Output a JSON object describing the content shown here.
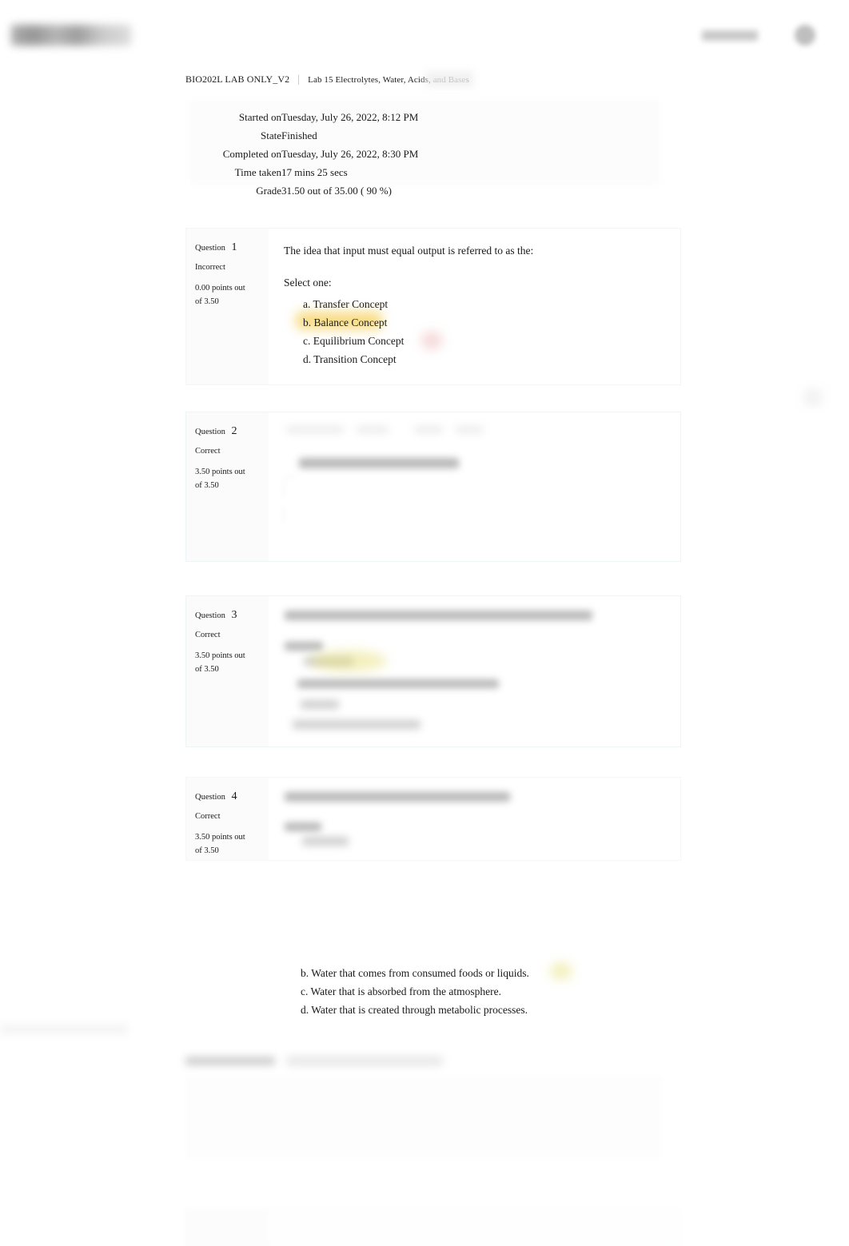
{
  "header": {
    "logo_name": "site-logo-redacted",
    "link_label": "",
    "avatar_label": ""
  },
  "breadcrumb": {
    "course": "BIO202L LAB ONLY_V2",
    "separator": "|",
    "quiz": "Lab 15 Electrolytes, Water, Acids, and Bases"
  },
  "summary": {
    "rows": [
      {
        "label": "Started on",
        "value": "Tuesday, July 26, 2022, 8:12 PM"
      },
      {
        "label": "State",
        "value": "Finished"
      },
      {
        "label": "Completed on",
        "value": "Tuesday, July 26, 2022, 8:30 PM"
      },
      {
        "label": "Time taken",
        "value": "17 mins 25 secs"
      },
      {
        "label": "Grade",
        "value": "31.50  out of 35.00 (  90 %)"
      }
    ]
  },
  "questions": [
    {
      "number_label": "Question",
      "number": "1",
      "state": "Incorrect",
      "points_line1": "0.00 points out",
      "points_line2": "of 3.50",
      "text": "The idea that input must equal output is referred to as the:",
      "select_one": "Select one:",
      "answers": [
        {
          "label": "a. Transfer Concept",
          "highlighted": false
        },
        {
          "label": "b. Balance Concept",
          "highlighted": true
        },
        {
          "label": "c. Equilibrium Concept",
          "highlighted": false
        },
        {
          "label": "d. Transition Concept",
          "highlighted": false
        }
      ]
    },
    {
      "number_label": "Question",
      "number": "2",
      "state": "Correct",
      "points_line1": "3.50 points out",
      "points_line2": "of 3.50",
      "text": "",
      "select_one": "",
      "answers": []
    },
    {
      "number_label": "Question",
      "number": "3",
      "state": "Correct",
      "points_line1": "3.50 points out",
      "points_line2": "of 3.50",
      "text": "",
      "select_one": "",
      "answers": []
    },
    {
      "number_label": "Question",
      "number": "4",
      "state": "Correct",
      "points_line1": "3.50 points out",
      "points_line2": "of 3.50",
      "text": "",
      "select_one": "",
      "answers": []
    }
  ],
  "floating_answers": [
    {
      "label": "b. Water that comes from consumed foods or liquids."
    },
    {
      "label": "c. Water that is absorbed from the atmosphere."
    },
    {
      "label": "d. Water that is created through metabolic processes."
    }
  ]
}
